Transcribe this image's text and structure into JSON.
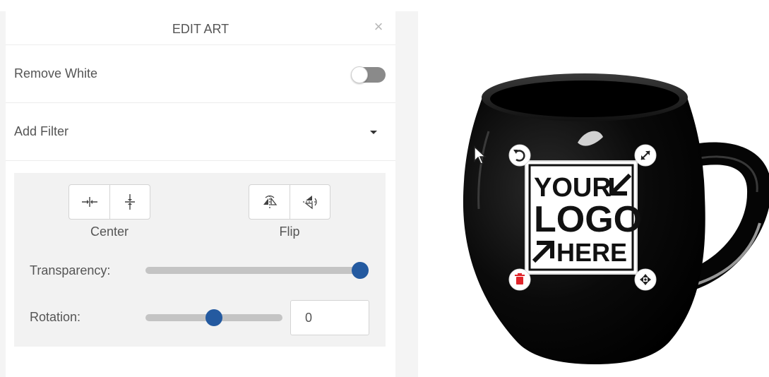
{
  "panel": {
    "title": "EDIT ART",
    "close_glyph": "×",
    "remove_white": {
      "label": "Remove White",
      "enabled": false
    },
    "add_filter": {
      "label": "Add Filter"
    }
  },
  "controls": {
    "center_label": "Center",
    "flip_label": "Flip",
    "transparency": {
      "label": "Transparency:",
      "value": 1.0
    },
    "rotation": {
      "label": "Rotation:",
      "slider_value": 0.5,
      "input_value": "0"
    }
  },
  "artwork": {
    "logo_lines": [
      "YOUR",
      "LOGO",
      "HERE"
    ],
    "icons": [
      "rotate-icon",
      "resize-icon",
      "delete-icon",
      "move-icon"
    ],
    "colors": {
      "mug": "#050505",
      "handle_delete": "#e0242a",
      "accent": "#245aa0"
    }
  }
}
